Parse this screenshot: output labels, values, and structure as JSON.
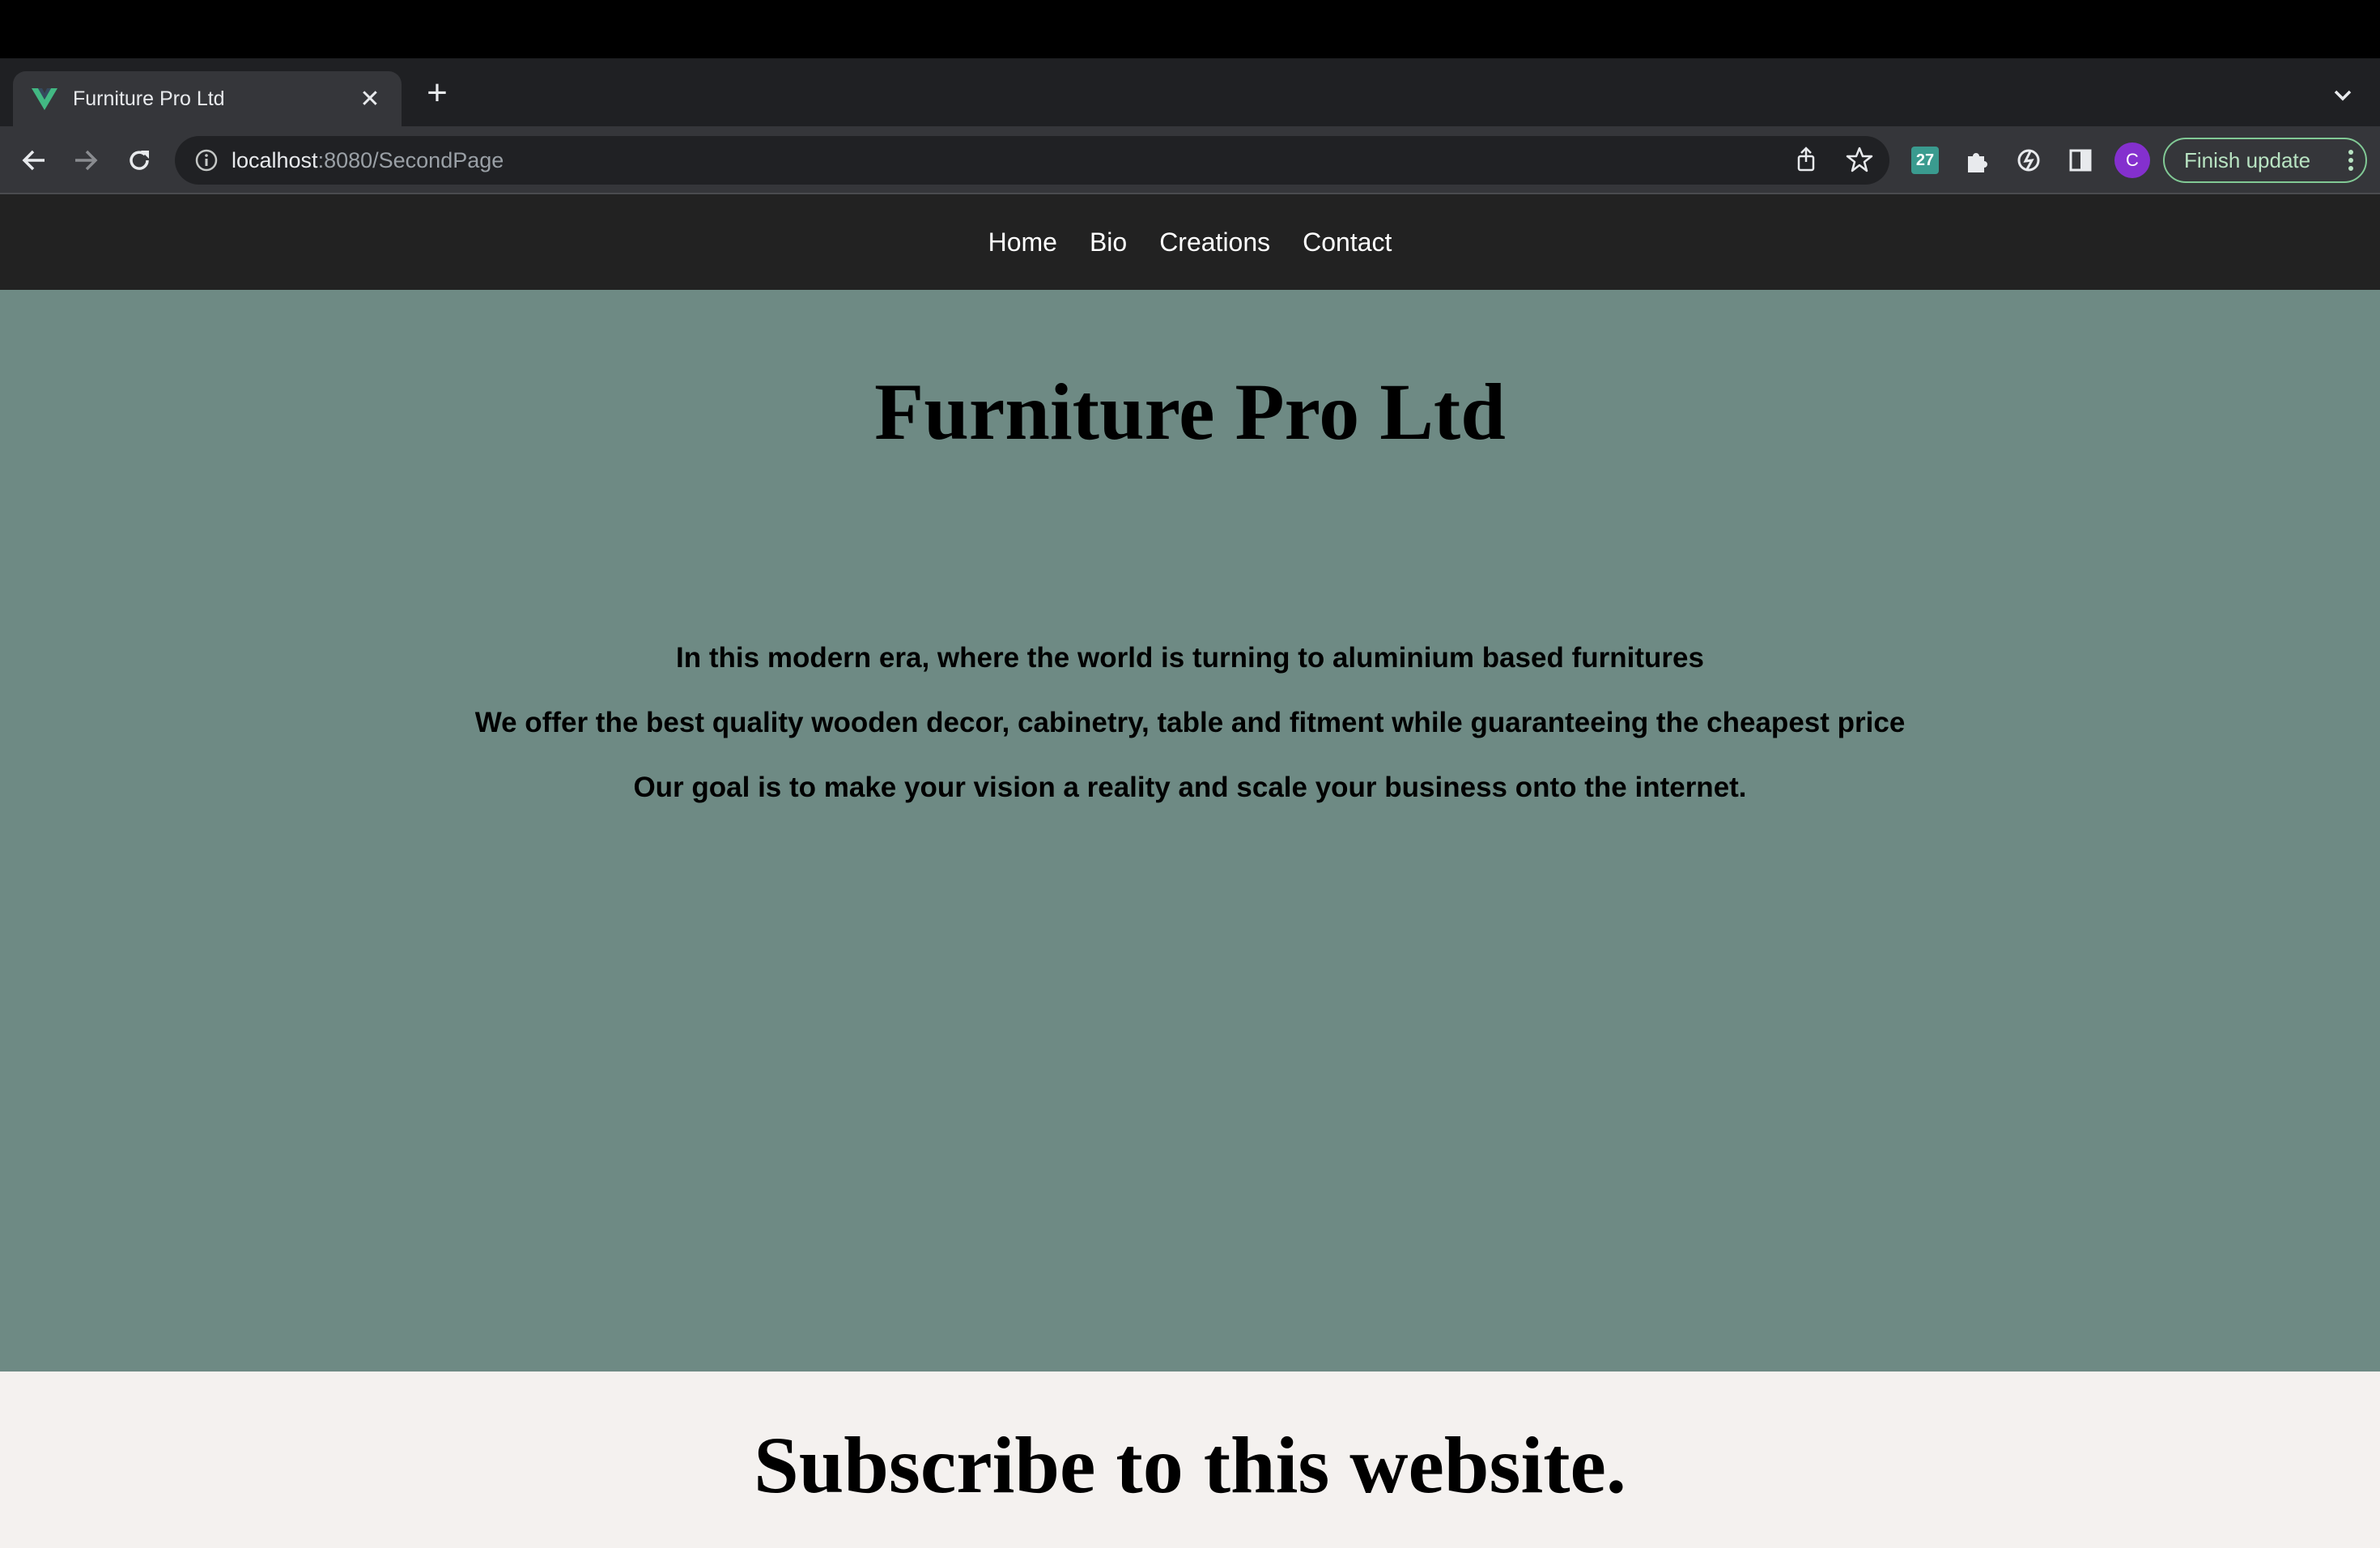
{
  "browser": {
    "tab_title": "Furniture Pro Ltd",
    "url_host": "localhost",
    "url_rest": ":8080/SecondPage",
    "avatar_letter": "C",
    "finish_update_label": "Finish update",
    "extension_badge": "27",
    "icons": [
      "vue-favicon",
      "close-icon",
      "plus-icon",
      "chevron-down-icon",
      "back-arrow-icon",
      "forward-arrow-icon",
      "reload-icon",
      "info-icon",
      "share-icon",
      "star-icon",
      "extension-badge-icon",
      "puzzle-icon",
      "extension-icon",
      "side-panel-icon",
      "kebab-menu-icon"
    ]
  },
  "site": {
    "nav": [
      "Home",
      "Bio",
      "Creations",
      "Contact"
    ],
    "title": "Furniture Pro Ltd",
    "lines": [
      "In this modern era, where the world is turning to aluminium based furnitures",
      "We offer the best quality wooden decor, cabinetry, table and fitment while guaranteeing the cheapest price",
      "Our goal is to make your vision a reality and scale your business onto the internet."
    ],
    "subscribe_title": "Subscribe to this website."
  },
  "colors": {
    "nav_bg": "#222222",
    "hero_bg": "#6e8a84",
    "subscribe_bg": "#f4f1ef",
    "avatar": "#8430ce",
    "update_accent": "#81c995"
  }
}
